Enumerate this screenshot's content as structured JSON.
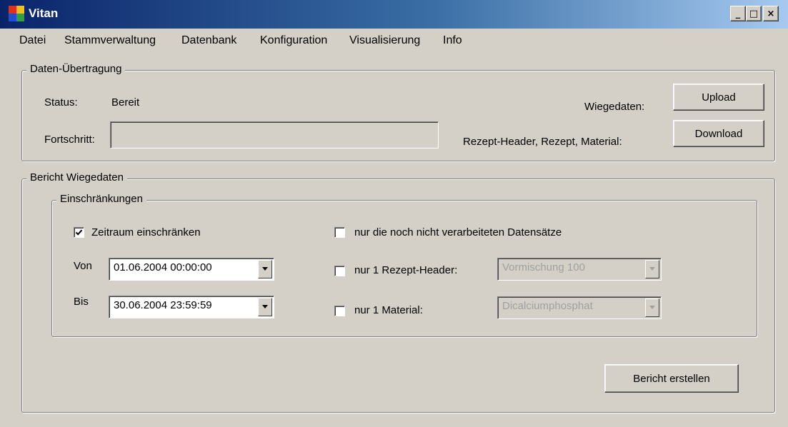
{
  "window": {
    "title": "Vitan",
    "minimize_glyph": "_",
    "maximize_glyph": "□",
    "close_glyph": "×"
  },
  "menu": {
    "items": [
      "Datei",
      "Stammverwaltung",
      "Datenbank",
      "Konfiguration",
      "Visualisierung",
      "Info"
    ]
  },
  "transfer": {
    "legend": "Daten-Übertragung",
    "status_label": "Status:",
    "status_value": "Bereit",
    "progress_label": "Fortschritt:",
    "progress_value": 0,
    "weigh_label": "Wiegedaten:",
    "upload_label": "Upload",
    "download_caption": "Rezept-Header, Rezept, Material:",
    "download_label": "Download"
  },
  "report": {
    "legend": "Bericht Wiegedaten",
    "restrictions_legend": "Einschränkungen",
    "timerange_label": "Zeitraum einschränken",
    "timerange_checked": true,
    "from_label": "Von",
    "from_value": "01.06.2004 00:00:00",
    "to_label": "Bis",
    "to_value": "30.06.2004 23:59:59",
    "unprocessed_label": "nur die noch nicht verarbeiteten Datensätze",
    "unprocessed_checked": false,
    "recipe_label": "nur 1 Rezept-Header:",
    "recipe_checked": false,
    "recipe_value": "Vormischung 100",
    "material_label": "nur 1 Material:",
    "material_checked": false,
    "material_value": "Dicalciumphosphat",
    "create_label": "Bericht erstellen"
  },
  "colors": {
    "face": "#d4d0c8",
    "title_start": "#0a246a",
    "title_end": "#a6caf0",
    "disabled_text": "#a0a0a0"
  },
  "icons": {
    "app": "app-icon",
    "dropdown": "chevron-down-icon",
    "check": "checkmark-icon"
  }
}
